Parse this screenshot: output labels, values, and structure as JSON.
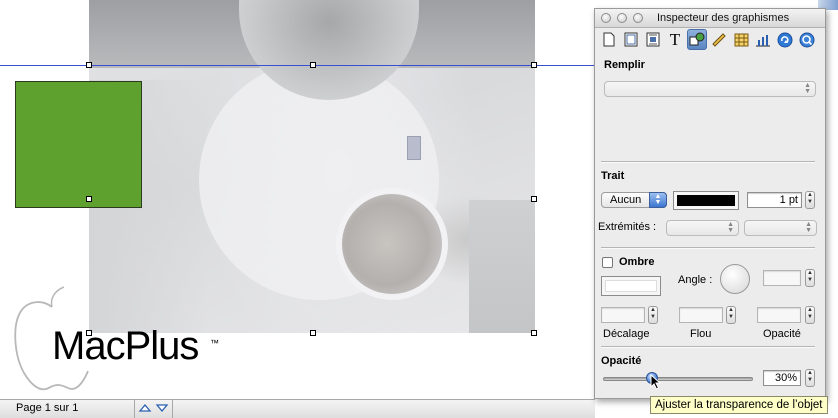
{
  "logo": {
    "brand": "MacPlus",
    "trademark": "™"
  },
  "status_bar": {
    "page_label": "Page 1 sur 1"
  },
  "inspector": {
    "title": "Inspecteur des graphismes",
    "toolbar": [
      {
        "icon": "document-icon"
      },
      {
        "icon": "layout-icon"
      },
      {
        "icon": "wrap-icon"
      },
      {
        "icon": "text-icon",
        "glyph": "T"
      },
      {
        "icon": "graphic-icon"
      },
      {
        "icon": "metrics-icon"
      },
      {
        "icon": "table-icon"
      },
      {
        "icon": "chart-icon"
      },
      {
        "icon": "link-icon"
      },
      {
        "icon": "quicktime-icon"
      }
    ],
    "fill": {
      "title": "Remplir",
      "value": ""
    },
    "stroke": {
      "title": "Trait",
      "style_value": "Aucun",
      "color": "#000000",
      "width_value": "1 pt",
      "endpoints_label": "Extrémités :",
      "endpoint_start": "",
      "endpoint_end": ""
    },
    "shadow": {
      "title": "Ombre",
      "checked": false,
      "angle_label": "Angle :",
      "angle_value": "",
      "offset_label": "Décalage",
      "blur_label": "Flou",
      "opacity_label": "Opacité",
      "offset_value": "",
      "blur_value": "",
      "opacity_value": ""
    },
    "opacity": {
      "title": "Opacité",
      "value": "30%",
      "level": 0.3
    }
  },
  "tooltip": {
    "text": "Ajuster la transparence de l’objet"
  },
  "colors": {
    "green_square": "#5ea12f",
    "guide_line": "#3a4fd0",
    "tooltip_bg": "#ffffc8"
  }
}
